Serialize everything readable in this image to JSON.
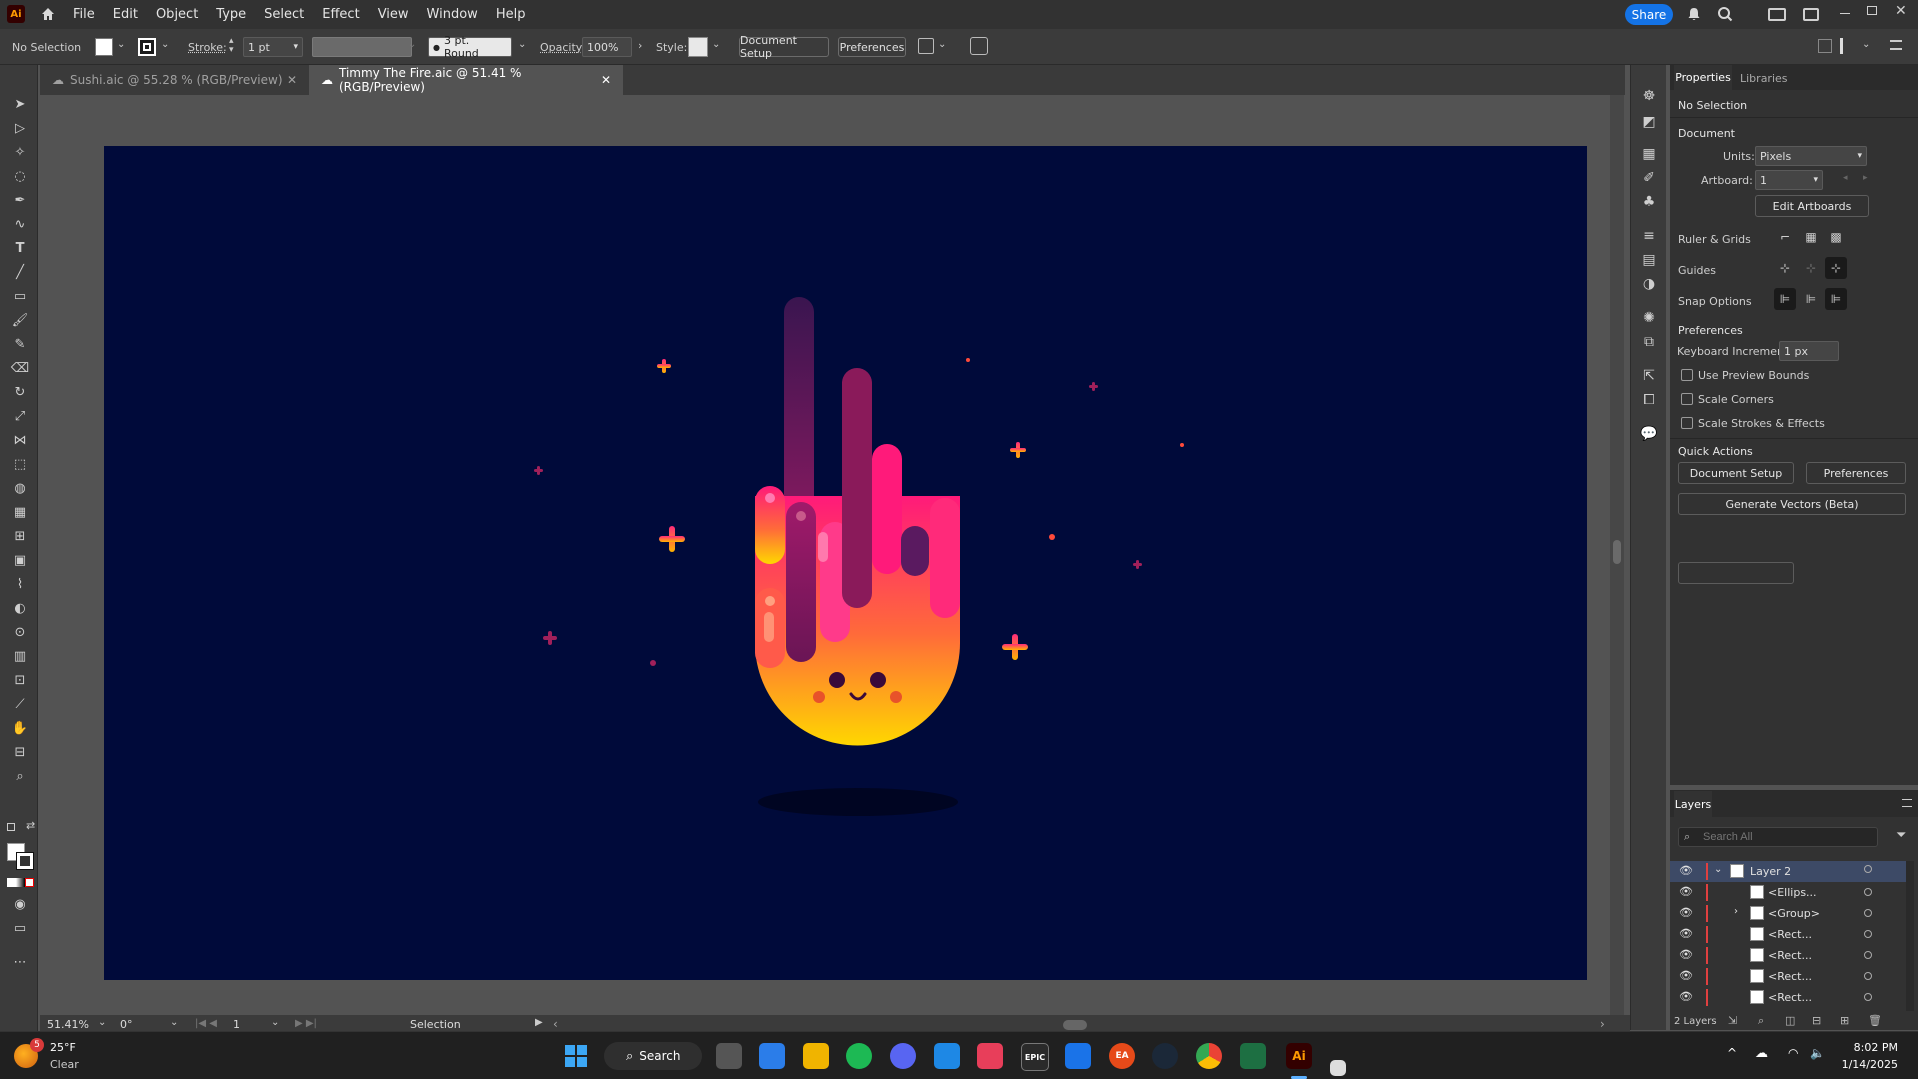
{
  "app": {
    "logo": "Ai"
  },
  "menu": [
    "File",
    "Edit",
    "Object",
    "Type",
    "Select",
    "Effect",
    "View",
    "Window",
    "Help"
  ],
  "titlebar": {
    "share_label": "Share"
  },
  "control": {
    "selection": "No Selection",
    "stroke_label": "Stroke:",
    "stroke_value": "1 pt",
    "brush_label": "3 pt. Round",
    "opacity_label": "Opacity:",
    "opacity_value": "100%",
    "style_label": "Style:",
    "document_setup": "Document Setup",
    "preferences": "Preferences"
  },
  "tabs": [
    {
      "label": "Sushi.aic @ 55.28 % (RGB/Preview)"
    },
    {
      "label": "Timmy The Fire.aic @ 51.41 % (RGB/Preview)"
    }
  ],
  "properties": {
    "tab_properties": "Properties",
    "tab_libraries": "Libraries",
    "no_selection": "No Selection",
    "document": "Document",
    "units_label": "Units:",
    "units_value": "Pixels",
    "artboard_label": "Artboard:",
    "artboard_value": "1",
    "edit_artboards": "Edit Artboards",
    "ruler_grids": "Ruler & Grids",
    "guides": "Guides",
    "snap_options": "Snap Options",
    "preferences": "Preferences",
    "keyboard_increment_label": "Keyboard Increment:",
    "keyboard_increment_value": "1 px",
    "use_preview_bounds": "Use Preview Bounds",
    "scale_corners": "Scale Corners",
    "scale_strokes": "Scale Strokes & Effects",
    "quick_actions": "Quick Actions",
    "qa_document_setup": "Document Setup",
    "qa_preferences": "Preferences",
    "generate_vectors": "Generate Vectors (Beta)"
  },
  "layers": {
    "title": "Layers",
    "search_placeholder": "Search All",
    "rows": [
      {
        "name": "Layer 2"
      },
      {
        "name": "<Ellips..."
      },
      {
        "name": "<Group>"
      },
      {
        "name": "<Rect..."
      },
      {
        "name": "<Rect..."
      },
      {
        "name": "<Rect..."
      },
      {
        "name": "<Rect..."
      }
    ],
    "count": "2 Layers"
  },
  "status": {
    "zoom": "51.41%",
    "rotation": "0°",
    "artboard": "1",
    "tool": "Selection"
  },
  "taskbar": {
    "weather_temp": "25°F",
    "weather_cond": "Clear",
    "weather_badge": "5",
    "search_label": "Search",
    "time": "8:02 PM",
    "date": "1/14/2025",
    "epic_label": "EPIC",
    "ea_label": "EA",
    "ai_label": "Ai"
  },
  "colors": {
    "artboard_bg": "#000a3a",
    "accent": "#1473e6",
    "ai_brand": "#ff9a00"
  }
}
